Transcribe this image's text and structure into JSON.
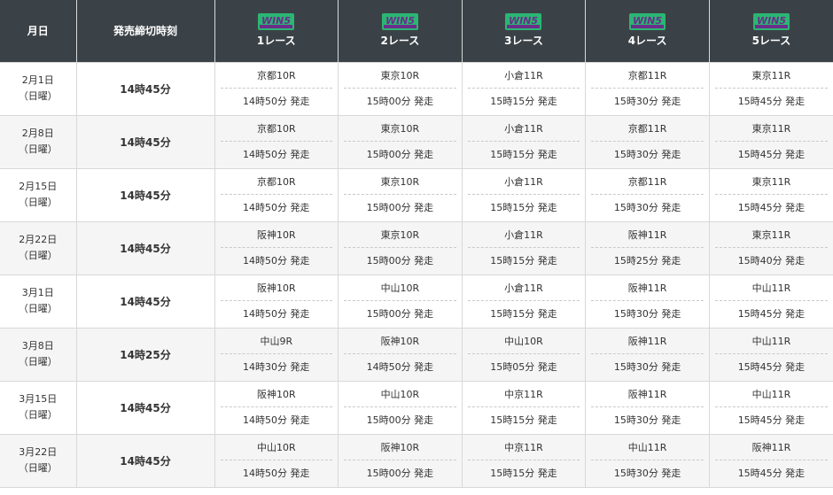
{
  "header": {
    "date_label": "月日",
    "cutoff_label": "発売締切時刻",
    "logo_text": "WIN5",
    "races": [
      "1レース",
      "2レース",
      "3レース",
      "4レース",
      "5レース"
    ]
  },
  "colors": {
    "header_bg": "#3b4247",
    "logo_green": "#2bb673",
    "logo_purple": "#6a2f8a",
    "alt_row": "#f5f5f5"
  },
  "rows": [
    {
      "date": "2月1日",
      "day": "（日曜）",
      "cutoff": "14時45分",
      "races": [
        {
          "track": "京都10R",
          "time": "14時50分 発走"
        },
        {
          "track": "東京10R",
          "time": "15時00分 発走"
        },
        {
          "track": "小倉11R",
          "time": "15時15分 発走"
        },
        {
          "track": "京都11R",
          "time": "15時30分 発走"
        },
        {
          "track": "東京11R",
          "time": "15時45分 発走"
        }
      ]
    },
    {
      "date": "2月8日",
      "day": "（日曜）",
      "cutoff": "14時45分",
      "races": [
        {
          "track": "京都10R",
          "time": "14時50分 発走"
        },
        {
          "track": "東京10R",
          "time": "15時00分 発走"
        },
        {
          "track": "小倉11R",
          "time": "15時15分 発走"
        },
        {
          "track": "京都11R",
          "time": "15時30分 発走"
        },
        {
          "track": "東京11R",
          "time": "15時45分 発走"
        }
      ]
    },
    {
      "date": "2月15日",
      "day": "（日曜）",
      "cutoff": "14時45分",
      "races": [
        {
          "track": "京都10R",
          "time": "14時50分 発走"
        },
        {
          "track": "東京10R",
          "time": "15時00分 発走"
        },
        {
          "track": "小倉11R",
          "time": "15時15分 発走"
        },
        {
          "track": "京都11R",
          "time": "15時30分 発走"
        },
        {
          "track": "東京11R",
          "time": "15時45分 発走"
        }
      ]
    },
    {
      "date": "2月22日",
      "day": "（日曜）",
      "cutoff": "14時45分",
      "races": [
        {
          "track": "阪神10R",
          "time": "14時50分 発走"
        },
        {
          "track": "東京10R",
          "time": "15時00分 発走"
        },
        {
          "track": "小倉11R",
          "time": "15時15分 発走"
        },
        {
          "track": "阪神11R",
          "time": "15時25分 発走"
        },
        {
          "track": "東京11R",
          "time": "15時40分 発走"
        }
      ]
    },
    {
      "date": "3月1日",
      "day": "（日曜）",
      "cutoff": "14時45分",
      "races": [
        {
          "track": "阪神10R",
          "time": "14時50分 発走"
        },
        {
          "track": "中山10R",
          "time": "15時00分 発走"
        },
        {
          "track": "小倉11R",
          "time": "15時15分 発走"
        },
        {
          "track": "阪神11R",
          "time": "15時30分 発走"
        },
        {
          "track": "中山11R",
          "time": "15時45分 発走"
        }
      ]
    },
    {
      "date": "3月8日",
      "day": "（日曜）",
      "cutoff": "14時25分",
      "races": [
        {
          "track": "中山9R",
          "time": "14時30分 発走"
        },
        {
          "track": "阪神10R",
          "time": "14時50分 発走"
        },
        {
          "track": "中山10R",
          "time": "15時05分 発走"
        },
        {
          "track": "阪神11R",
          "time": "15時30分 発走"
        },
        {
          "track": "中山11R",
          "time": "15時45分 発走"
        }
      ]
    },
    {
      "date": "3月15日",
      "day": "（日曜）",
      "cutoff": "14時45分",
      "races": [
        {
          "track": "阪神10R",
          "time": "14時50分 発走"
        },
        {
          "track": "中山10R",
          "time": "15時00分 発走"
        },
        {
          "track": "中京11R",
          "time": "15時15分 発走"
        },
        {
          "track": "阪神11R",
          "time": "15時30分 発走"
        },
        {
          "track": "中山11R",
          "time": "15時45分 発走"
        }
      ]
    },
    {
      "date": "3月22日",
      "day": "（日曜）",
      "cutoff": "14時45分",
      "races": [
        {
          "track": "中山10R",
          "time": "14時50分 発走"
        },
        {
          "track": "阪神10R",
          "time": "15時00分 発走"
        },
        {
          "track": "中京11R",
          "time": "15時15分 発走"
        },
        {
          "track": "中山11R",
          "time": "15時30分 発走"
        },
        {
          "track": "阪神11R",
          "time": "15時45分 発走"
        }
      ]
    }
  ]
}
